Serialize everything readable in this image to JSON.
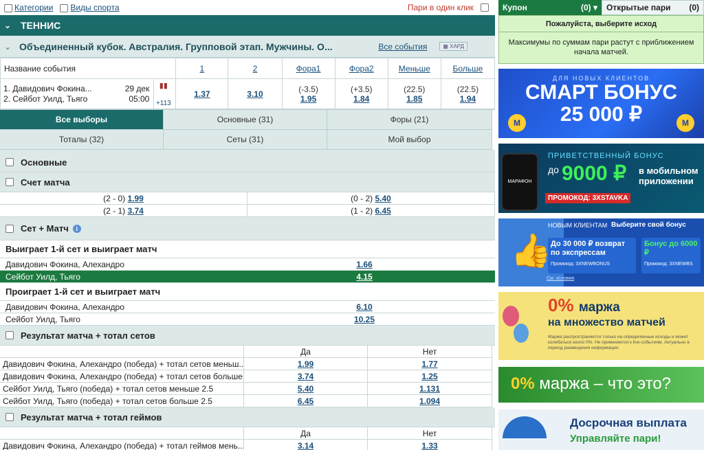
{
  "topbar": {
    "categories": "Категории",
    "sports": "Виды спорта",
    "one_click": "Пари в один клик"
  },
  "sport": {
    "title": "ТЕННИС"
  },
  "league": {
    "name": "Объединенный кубок. Австралия. Групповой этап. Мужчины. О...",
    "all_events": "Все события",
    "badge": "ХАРД"
  },
  "event_table": {
    "headers": [
      "Название события",
      "1",
      "2",
      "Фора1",
      "Фора2",
      "Меньше",
      "Больше"
    ],
    "player1": "1. Давидович Фокина...",
    "player2": "2. Сейбот Уилд, Тьяго",
    "date": "29 дек",
    "time": "05:00",
    "more": "+113",
    "odds": [
      {
        "p": "",
        "v": "1.37"
      },
      {
        "p": "",
        "v": "3.10"
      },
      {
        "p": "(-3.5)",
        "v": "1.95"
      },
      {
        "p": "(+3.5)",
        "v": "1.84"
      },
      {
        "p": "(22.5)",
        "v": "1.85"
      },
      {
        "p": "(22.5)",
        "v": "1.94"
      }
    ]
  },
  "tabs": [
    "Все выборы",
    "Основные (31)",
    "Форы (21)",
    "Тоталы (32)",
    "Сеты (31)",
    "Мой выбор"
  ],
  "markets": {
    "main": "Основные",
    "score": "Счет матча",
    "set_match": "Сет + Матч",
    "result_sets": "Результат матча + тотал сетов",
    "result_games": "Результат матча + тотал геймов"
  },
  "score_rows": [
    {
      "a": "(2 - 0)",
      "av": "1.99",
      "b": "(0 - 2)",
      "bv": "5.40"
    },
    {
      "a": "(2 - 1)",
      "av": "3.74",
      "b": "(1 - 2)",
      "bv": "6.45"
    }
  ],
  "win_first": {
    "title": "Выиграет 1-й сет и выиграет матч",
    "rows": [
      {
        "n": "Давидович Фокина, Алехандро",
        "v": "1.66"
      },
      {
        "n": "Сейбот Уилд, Тьяго",
        "v": "4.15"
      }
    ]
  },
  "lose_first": {
    "title": "Проиграет 1-й сет и выиграет матч",
    "rows": [
      {
        "n": "Давидович Фокина, Алехандро",
        "v": "6.10"
      },
      {
        "n": "Сейбот Уилд, Тьяго",
        "v": "10.25"
      }
    ]
  },
  "yes": "Да",
  "no": "Нет",
  "sets_rows": [
    {
      "n": "Давидович Фокина, Алехандро (победа) + тотал сетов меньш...",
      "y": "1.99",
      "no": "1.77"
    },
    {
      "n": "Давидович Фокина, Алехандро (победа) + тотал сетов больше...",
      "y": "3.74",
      "no": "1.25"
    },
    {
      "n": "Сейбот Уилд, Тьяго (победа) + тотал сетов меньше 2.5",
      "y": "5.40",
      "no": "1.131"
    },
    {
      "n": "Сейбот Уилд, Тьяго (победа) + тотал сетов больше 2.5",
      "y": "6.45",
      "no": "1.094"
    }
  ],
  "games_rows": [
    {
      "n": "Давидович Фокина, Алехандро (победа) + тотал геймов мень...",
      "y": "3.14",
      "no": "1.33"
    }
  ],
  "coupon": {
    "tab": "Купон",
    "count": "(0)",
    "open": "Открытые пари",
    "open_count": "(0)",
    "title": "Пожалуйста, выберите исход",
    "desc": "Максимумы по суммам пари растут с приближением начала матчей."
  },
  "banners": {
    "b1": {
      "top": "ДЛЯ НОВЫХ КЛИЕНТОВ",
      "l1": "СМАРТ БОНУС",
      "l2": "25 000 ₽"
    },
    "b2": {
      "top": "ПРИВЕТСТВЕННЫЙ БОНУС",
      "pre": "до",
      "amt": "9000 ₽",
      "side": "в мобильном приложении",
      "promo": "ПРОМОКОД: 3XSTAVKA",
      "phone": "МАРАФОН"
    },
    "b3": {
      "tag": "НОВЫМ КЛИЕНТАМ",
      "head": "Выберите свой бонус",
      "c1": "До 30 000 ₽ возврат по экспрессам",
      "c1p": "Промокод: 3XNEWBONUS",
      "c2": "Бонус до 6000 ₽",
      "c2p": "Промокод: 3XNEWBS",
      "terms": "См. условия"
    },
    "b4": {
      "pct": "0%",
      "l1": "маржа",
      "l2": "на множество матчей",
      "note": "Маржа распространяется только на определенные исходы и может колебаться около 0%. Не применяется к live-событиям. Актуально в период размещения информации."
    },
    "b5": {
      "pct": "0%",
      "rest": "маржа – что это?"
    },
    "b6": {
      "l1": "Досрочная выплата",
      "l2": "Управляйте пари!"
    }
  }
}
